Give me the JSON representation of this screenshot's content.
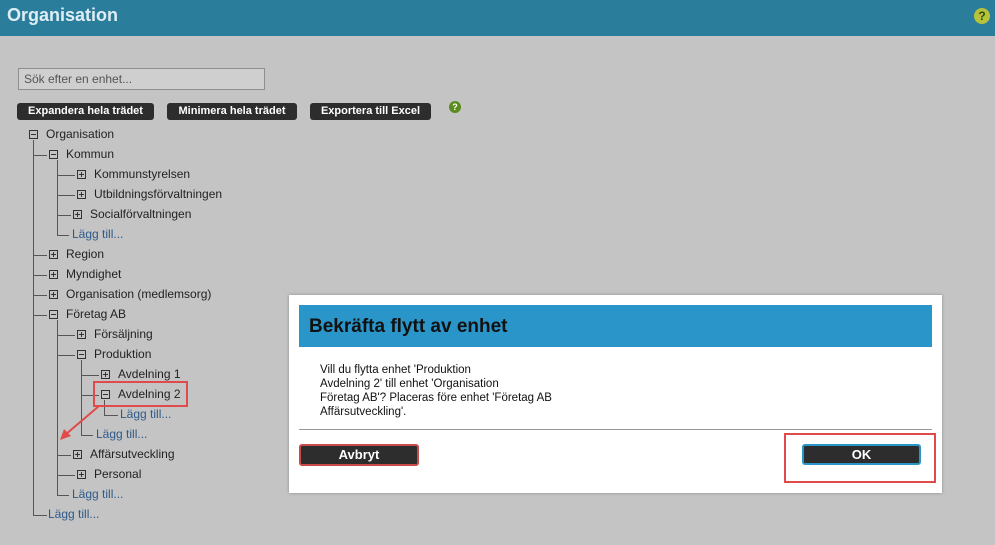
{
  "header": {
    "title": "Organisation",
    "help_icon": "?"
  },
  "search": {
    "placeholder": "Sök efter en enhet...",
    "value": ""
  },
  "toolbar": {
    "expand_label": "Expandera hela trädet",
    "collapse_label": "Minimera hela trädet",
    "export_label": "Exportera till Excel",
    "help_icon": "?"
  },
  "tree": {
    "root": "Organisation",
    "kommun": "Kommun",
    "kommunstyrelsen": "Kommunstyrelsen",
    "utbildning": "Utbildningsförvaltningen",
    "social": "Socialförvaltningen",
    "add_kommun": "Lägg till...",
    "region": "Region",
    "myndighet": "Myndighet",
    "medlemsorg": "Organisation (medlemsorg)",
    "foretag": "Företag AB",
    "forsaljning": "Försäljning",
    "produktion": "Produktion",
    "avd1": "Avdelning 1",
    "avd2": "Avdelning 2",
    "add_avd2": "Lägg till...",
    "add_produktion": "Lägg till...",
    "affar": "Affärsutveckling",
    "personal": "Personal",
    "add_foretag": "Lägg till...",
    "add_root": "Lägg till..."
  },
  "modal": {
    "title": "Bekräfta flytt av enhet",
    "message_lines": [
      "Vill du flytta enhet 'Produktion",
      "Avdelning 2' till enhet 'Organisation",
      "Företag AB'? Placeras före enhet 'Företag AB",
      "Affärsutveckling'."
    ],
    "cancel_label": "Avbryt",
    "ok_label": "OK"
  },
  "colors": {
    "header_bg": "#2b7d9c",
    "modal_header_bg": "#2a95c8",
    "highlight": "#e04a4a",
    "page_bg": "#c4c4c4",
    "button_bg": "#2d2d2d"
  }
}
